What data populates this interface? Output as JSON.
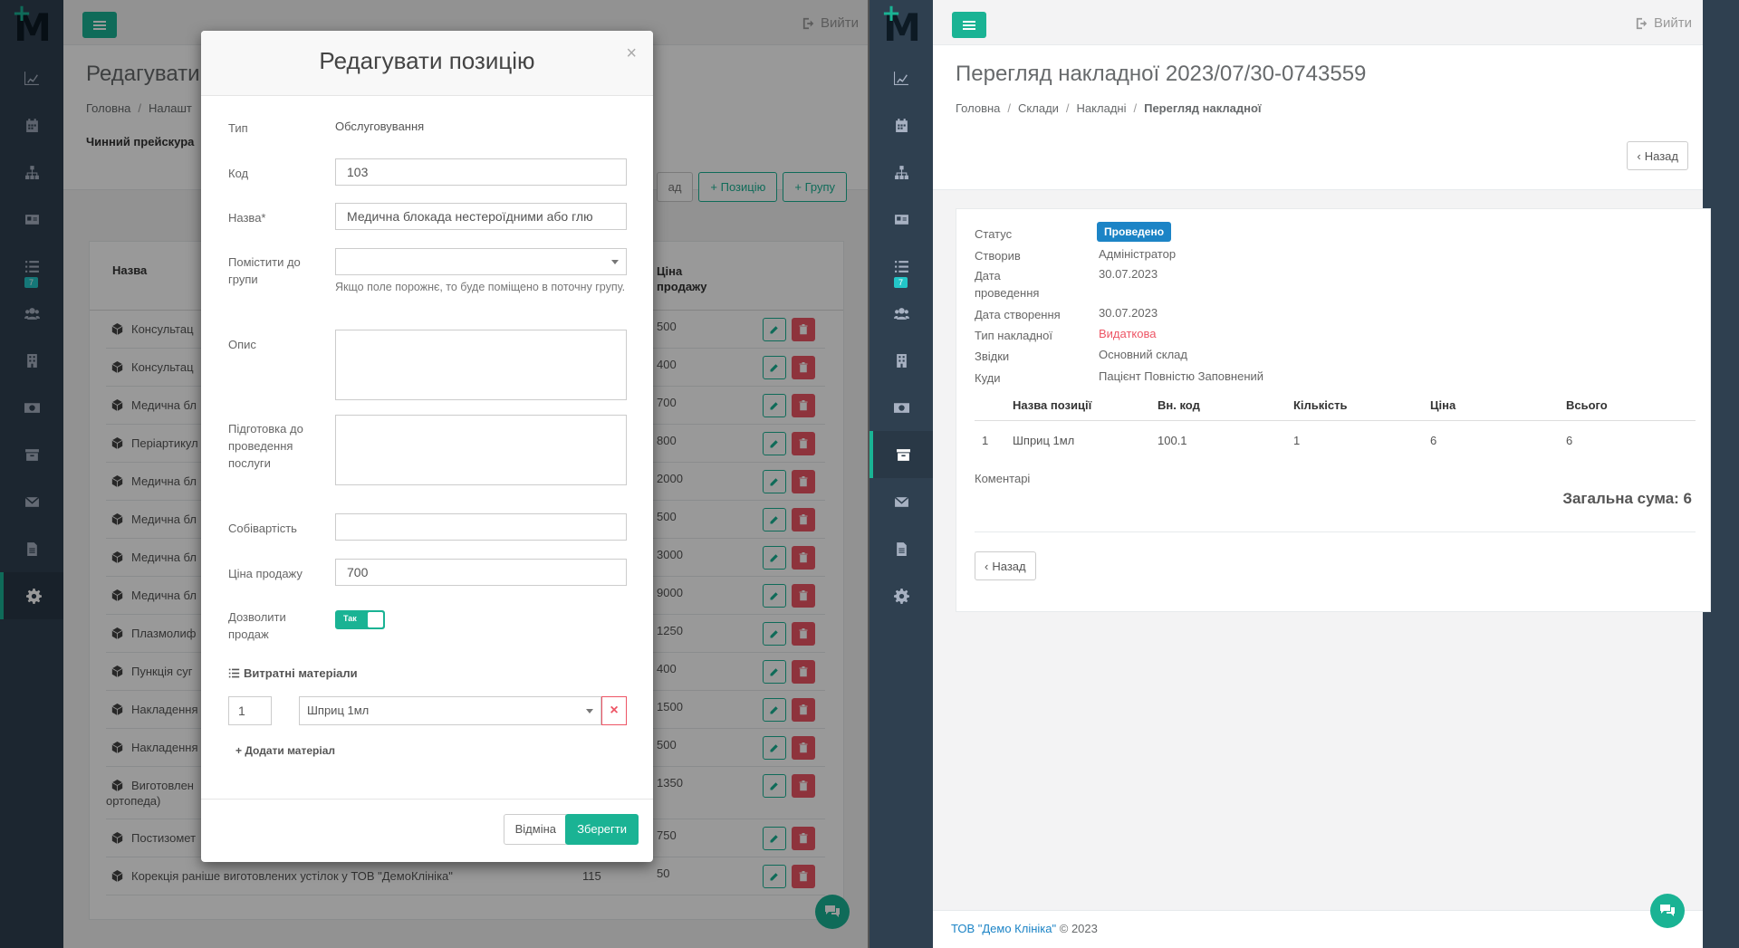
{
  "left": {
    "topbar": {
      "logout_label": "Вийти"
    },
    "page": {
      "title": "Редагувати",
      "breadcrumb": [
        "Головна",
        "Налашт"
      ],
      "pricelist_label": "Чинний прейскура",
      "buttons": {
        "back": "ад",
        "add_position": "+ Позицію",
        "add_group": "+ Групу"
      }
    },
    "list": {
      "col_name": "Назва",
      "col_price": "Ціна продажу",
      "rows": [
        {
          "name": "Консультац",
          "price": "500"
        },
        {
          "name": "Консультац",
          "price": "400"
        },
        {
          "name": "Медична бл",
          "price": "700"
        },
        {
          "name": "Періартикул",
          "price": "800"
        },
        {
          "name": "Медична бл",
          "price": "2000"
        },
        {
          "name": "Медична бл",
          "price": "500"
        },
        {
          "name": "Медична бл",
          "price": "3000"
        },
        {
          "name": "Медична бл",
          "price": "9000"
        },
        {
          "name": "Плазмолиф",
          "price": "1250"
        },
        {
          "name": "Пункція суг",
          "price": "400"
        },
        {
          "name": "Накладення",
          "price": "1500"
        },
        {
          "name": "Накладення",
          "price": "500"
        },
        {
          "name": "Виготовлен",
          "name2": "ортопеда)",
          "price": "1350"
        },
        {
          "name": "Постизомет",
          "price": "750"
        },
        {
          "name": "Корекція раніше виготовлених устілок у ТОВ \"ДемоКлініка\"",
          "code": "115",
          "price": "50"
        }
      ]
    },
    "sidebar_badge": "7",
    "modal": {
      "title": "Редагувати позицію",
      "close": "×",
      "type_label": "Тип",
      "type_value": "Обслуговування",
      "code_label": "Код",
      "code_value": "103",
      "name_label": "Назва*",
      "name_value": "Медична блокада нестероїдними або глю",
      "group_label": "Помістити до групи",
      "group_help": "Якщо поле порожнє, то буде поміщено в поточну групу.",
      "desc_label": "Опис",
      "prep_label": "Підготовка до проведення послуги",
      "cost_label": "Собівартість",
      "price_label": "Ціна продажу",
      "price_value": "700",
      "allow_label": "Дозволити продаж",
      "allow_toggle": "Так",
      "materials_title": "Витратні матеріали",
      "material_qty": "1",
      "material_name": "Шприц 1мл",
      "material_remove": "×",
      "add_material": "+ Додати матеріал",
      "cancel": "Відміна",
      "save": "Зберегти"
    }
  },
  "right": {
    "topbar": {
      "logout_label": "Вийти"
    },
    "sidebar_badge": "7",
    "page": {
      "title": "Перегляд накладної 2023/07/30-0743559",
      "breadcrumb": [
        "Головна",
        "Склади",
        "Накладні"
      ],
      "breadcrumb_current": "Перегляд накладної",
      "back": "Назад"
    },
    "invoice": {
      "status_label": "Статус",
      "status_value": "Проведено",
      "creator_label": "Створив",
      "creator_value": "Адміністратор",
      "conduct_label": "Дата проведення",
      "conduct_value": "30.07.2023",
      "created_label": "Дата створення",
      "created_value": "30.07.2023",
      "type_label": "Тип накладної",
      "type_value": "Видаткова",
      "from_label": "Звідки",
      "from_value": "Основний склад",
      "to_label": "Куди",
      "to_value": "Пацієнт Повністю Заповнений",
      "table": {
        "headers": [
          "Назва позиції",
          "Вн. код",
          "Кількість",
          "Ціна",
          "Всього"
        ],
        "rows": [
          {
            "n": "1",
            "name": "Шприц 1мл",
            "code": "100.1",
            "qty": "1",
            "price": "6",
            "total": "6"
          }
        ]
      },
      "comments_label": "Коментарі",
      "total_label": "Загальна сума: 6",
      "back": "Назад"
    },
    "footer": {
      "company": "ТОВ \"Демо Клініка\"",
      "copyright": "© 2023"
    }
  },
  "colors": {
    "accent": "#1ab394",
    "danger": "#ed5565",
    "primary": "#1c84c6",
    "sidebar": "#2f4050"
  }
}
